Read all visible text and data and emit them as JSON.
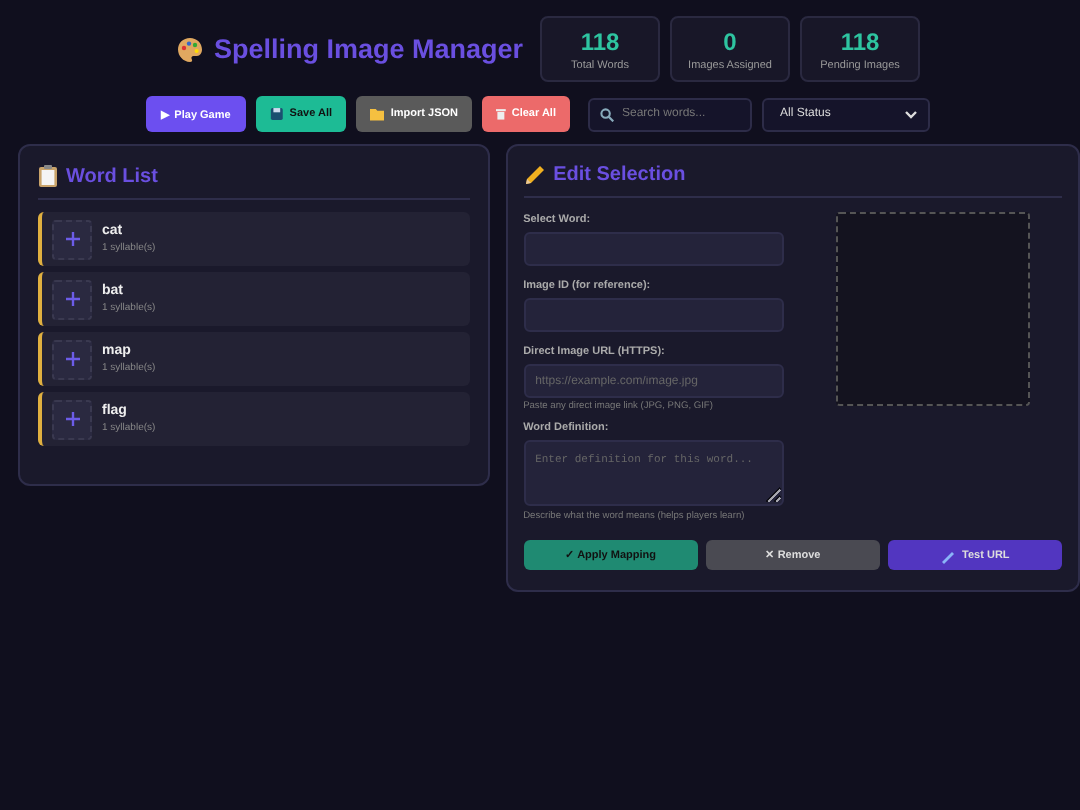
{
  "header": {
    "title": "Spelling Image Manager"
  },
  "stats": [
    {
      "value": "118",
      "label": "Total Words"
    },
    {
      "value": "0",
      "label": "Images Assigned"
    },
    {
      "value": "118",
      "label": "Pending Images"
    }
  ],
  "toolbar": {
    "buttons": [
      {
        "label": "▶ Play Game",
        "kind": "play"
      },
      {
        "label": "Save All",
        "kind": "save"
      },
      {
        "label": "Import JSON",
        "kind": "import"
      },
      {
        "label": "Clear All",
        "kind": "clear"
      }
    ],
    "search": {
      "placeholder": "Search words..."
    },
    "filter": {
      "value": "All Status"
    }
  },
  "word_list": {
    "title": "Word List",
    "items": [
      {
        "word": "cat",
        "syllables": "1 syllable(s)"
      },
      {
        "word": "bat",
        "syllables": "1 syllable(s)"
      },
      {
        "word": "map",
        "syllables": "1 syllable(s)"
      },
      {
        "word": "flag",
        "syllables": "1 syllable(s)"
      }
    ]
  },
  "editor": {
    "title": "Edit Selection",
    "fields": [
      {
        "label": "Select Word:",
        "kind": "input"
      },
      {
        "label": "Image ID (for reference):",
        "kind": "input"
      },
      {
        "label": "Direct Image URL (HTTPS):",
        "kind": "input",
        "placeholder": "https://example.com/image.jpg",
        "hint": "Paste any direct image link (JPG, PNG, GIF)"
      },
      {
        "label": "Word Definition:",
        "kind": "textarea",
        "placeholder": "Enter definition for this word...",
        "hint": "Describe what the word means (helps players learn)"
      }
    ],
    "buttons": [
      {
        "label": "✓ Apply Mapping",
        "kind": "apply"
      },
      {
        "label": "✕ Remove",
        "kind": "remove"
      },
      {
        "label": "Test URL",
        "kind": "test"
      }
    ]
  }
}
